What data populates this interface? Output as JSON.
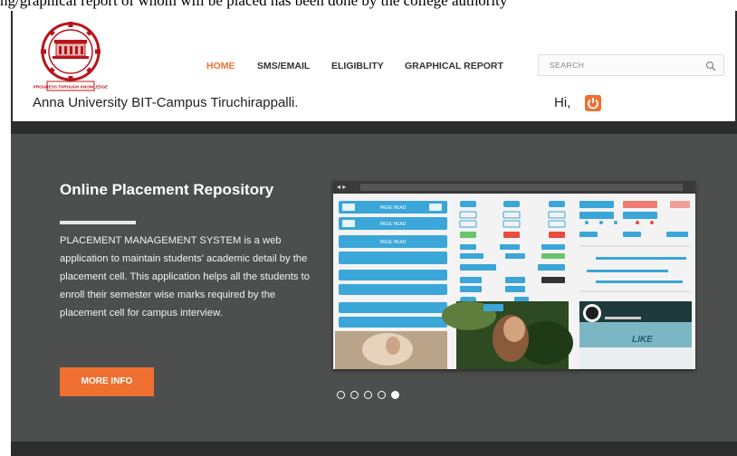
{
  "caption": "ng/graphical report of whom will be placed has been done by the college authority",
  "header": {
    "logo_caption": "PROGRESS THROUGH KNOWLEDGE",
    "nav": [
      {
        "label": "HOME",
        "active": true
      },
      {
        "label": "SMS/EMAIL",
        "active": false
      },
      {
        "label": "ELIGIBLITY",
        "active": false
      },
      {
        "label": "GRAPHICAL REPORT",
        "active": false
      }
    ],
    "search_placeholder": "SEARCH",
    "university": "Anna University BIT-Campus Tiruchirappalli.",
    "greeting": "Hi,"
  },
  "hero": {
    "title": "Online Placement Repository",
    "description": "PLACEMENT MANAGEMENT SYSTEM is a web application to maintain students' academic detail by the placement cell. This application helps all the students to enroll their semester wise marks required by the placement cell for campus interview.",
    "button": "MORE INFO",
    "slide_count": 5,
    "active_slide": 5,
    "mockup_labels": {
      "page_head": "PAGE HEAD",
      "like": "LIKE"
    }
  },
  "colors": {
    "accent": "#ef7031",
    "hero_bg": "#4d4e4e",
    "frame_dark": "#2d2d2d",
    "mockup_blue": "#3ba6d8"
  }
}
